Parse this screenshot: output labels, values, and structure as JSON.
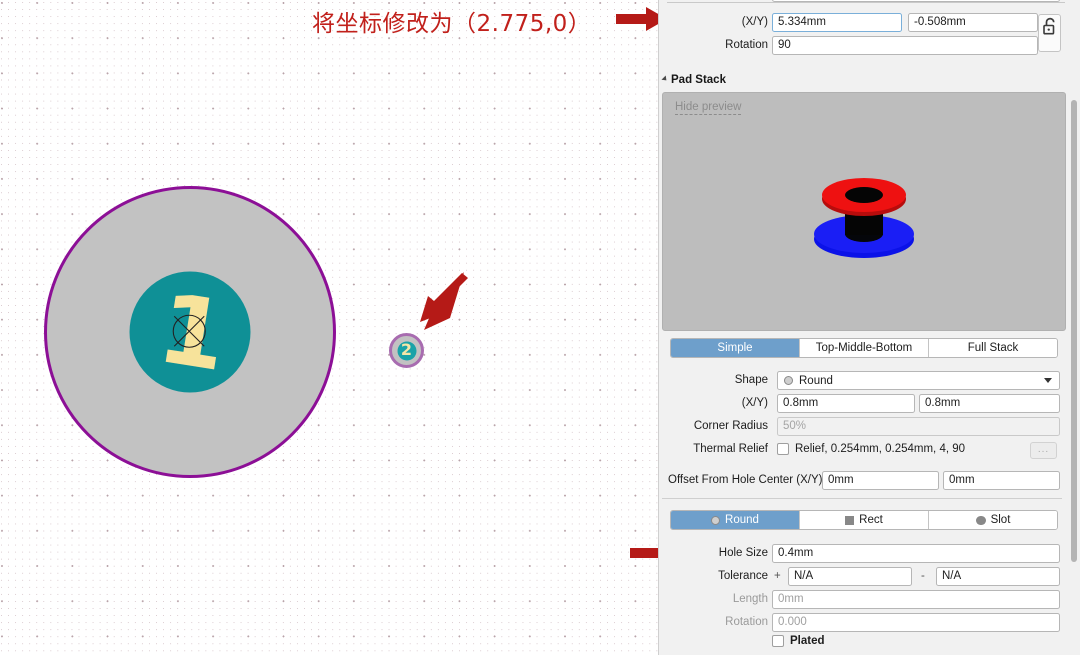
{
  "annotation": {
    "text": "将坐标修改为（2.775,0）",
    "color": "#c1201b",
    "arrow_color": "#b51a17"
  },
  "canvas": {
    "name": "pcb-footprint-editor-canvas",
    "background": "#ffffff",
    "pads": [
      {
        "designator": "1",
        "ring_color": "#8c0f96",
        "fill_color": "#c2c2c2",
        "hole_color": "#0f9096",
        "text_color": "#f7e39b"
      },
      {
        "designator": "2",
        "ring_color": "#a86cb0",
        "fill_color": "#c2c2c2",
        "hole_color": "#1aa3a8",
        "text_color": "#f4e6a8"
      }
    ]
  },
  "panel": {
    "position": {
      "xy_label": "(X/Y)",
      "x_value": "5.334mm",
      "y_value": "-0.508mm",
      "rotation_label": "Rotation",
      "rotation_value": "90",
      "lock_icon": "unlock-icon"
    },
    "pad_stack": {
      "section_title": "Pad Stack",
      "hide_preview_label": "Hide preview",
      "preview_icon": "via-3d-preview",
      "stack_tabs": [
        {
          "label": "Simple",
          "selected": true
        },
        {
          "label": "Top-Middle-Bottom",
          "selected": false
        },
        {
          "label": "Full Stack",
          "selected": false
        }
      ],
      "shape_label": "Shape",
      "shape_value": "Round",
      "size_label": "(X/Y)",
      "size_x": "0.8mm",
      "size_y": "0.8mm",
      "corner_radius_label": "Corner Radius",
      "corner_radius_value": "50%",
      "thermal_relief_label": "Thermal Relief",
      "thermal_relief_value": "Relief, 0.254mm, 0.254mm, 4, 90",
      "thermal_relief_checked": false,
      "more_button_label": "...",
      "offset_label": "Offset From Hole Center (X/Y)",
      "offset_x": "0mm",
      "offset_y": "0mm"
    },
    "hole": {
      "hole_tabs": [
        {
          "label": "Round",
          "selected": true,
          "icon": "circle-outline-icon"
        },
        {
          "label": "Rect",
          "selected": false,
          "icon": "square-filled-icon"
        },
        {
          "label": "Slot",
          "selected": false,
          "icon": "slot-filled-icon"
        }
      ],
      "hole_size_label": "Hole Size",
      "hole_size_value": "0.4mm",
      "tolerance_label": "Tolerance",
      "tolerance_plus_sign": "+",
      "tolerance_plus_value": "N/A",
      "tolerance_minus_sign": "-",
      "tolerance_minus_value": "N/A",
      "length_label": "Length",
      "length_value": "0mm",
      "hole_rotation_label": "Rotation",
      "hole_rotation_value": "0.000",
      "plated_label": "Plated",
      "plated_checked": false
    }
  }
}
